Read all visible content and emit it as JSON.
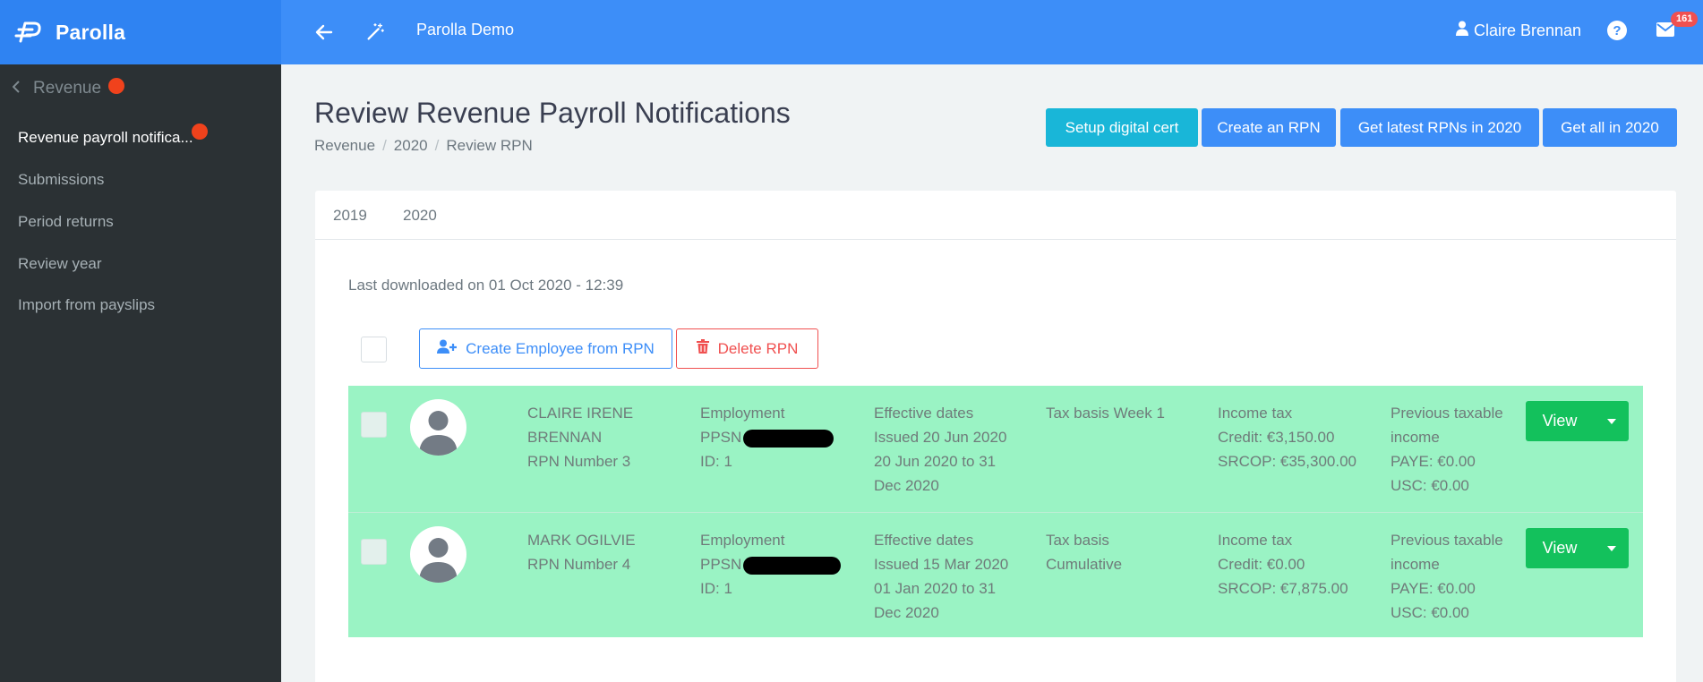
{
  "brand": {
    "name": "Parolla"
  },
  "header": {
    "app_title": "Parolla Demo",
    "user_name": "Claire Brennan",
    "help_glyph": "?",
    "mail_count": "161"
  },
  "sidebar": {
    "back_label": "Revenue",
    "items": [
      {
        "label": "Revenue payroll notifica..."
      },
      {
        "label": "Submissions"
      },
      {
        "label": "Period returns"
      },
      {
        "label": "Review year"
      },
      {
        "label": "Import from payslips"
      }
    ]
  },
  "page": {
    "title": "Review Revenue Payroll Notifications",
    "breadcrumb": [
      "Revenue",
      "2020",
      "Review RPN"
    ],
    "breadcrumb_sep": "/",
    "buttons": {
      "setup_cert": "Setup digital cert",
      "create_rpn": "Create an RPN",
      "get_latest": "Get latest RPNs in 2020",
      "get_all": "Get all in 2020"
    }
  },
  "tabs": [
    {
      "label": "2019"
    },
    {
      "label": "2020"
    }
  ],
  "last_downloaded": "Last downloaded on 01 Oct 2020 - 12:39",
  "actions": {
    "create_employee": "Create Employee from RPN",
    "delete_rpn": "Delete RPN"
  },
  "rows": [
    {
      "name_lines": [
        "CLAIRE IRENE",
        "BRENNAN",
        "RPN Number 3"
      ],
      "employment_lines": [
        "Employment",
        "PPSN",
        "ID: 1"
      ],
      "dates_lines": [
        "Effective dates",
        "Issued 20 Jun 2020",
        "20 Jun 2020 to 31",
        "Dec 2020"
      ],
      "tax_basis_lines": [
        "Tax basis Week 1"
      ],
      "income_tax_lines": [
        "Income tax",
        "Credit: €3,150.00",
        "SRCOP: €35,300.00"
      ],
      "previous_lines": [
        "Previous taxable",
        "income",
        "PAYE: €0.00",
        "USC: €0.00"
      ],
      "view_label": "View"
    },
    {
      "name_lines": [
        "MARK OGILVIE",
        "RPN Number 4"
      ],
      "employment_lines": [
        "Employment",
        "PPSN",
        "ID: 1"
      ],
      "dates_lines": [
        "Effective dates",
        "Issued 15 Mar 2020",
        "01 Jan 2020 to 31",
        "Dec 2020"
      ],
      "tax_basis_lines": [
        "Tax basis",
        "Cumulative"
      ],
      "income_tax_lines": [
        "Income tax",
        "Credit: €0.00",
        "SRCOP: €7,875.00"
      ],
      "previous_lines": [
        "Previous taxable",
        "income",
        "PAYE: €0.00",
        "USC: €0.00"
      ],
      "view_label": "View"
    }
  ],
  "colors": {
    "topbar": "#3d8ef8",
    "sidebar": "#2b3134",
    "row_highlight": "#9af3c4",
    "view_button": "#13c15c",
    "notification_dot": "#f0421c"
  },
  "icons": [
    "logo-icon",
    "back-arrow-icon",
    "magic-wand-icon",
    "user-icon",
    "help-icon",
    "mail-icon",
    "chevron-left-icon",
    "user-plus-icon",
    "trash-icon",
    "avatar-icon",
    "caret-down-icon"
  ]
}
